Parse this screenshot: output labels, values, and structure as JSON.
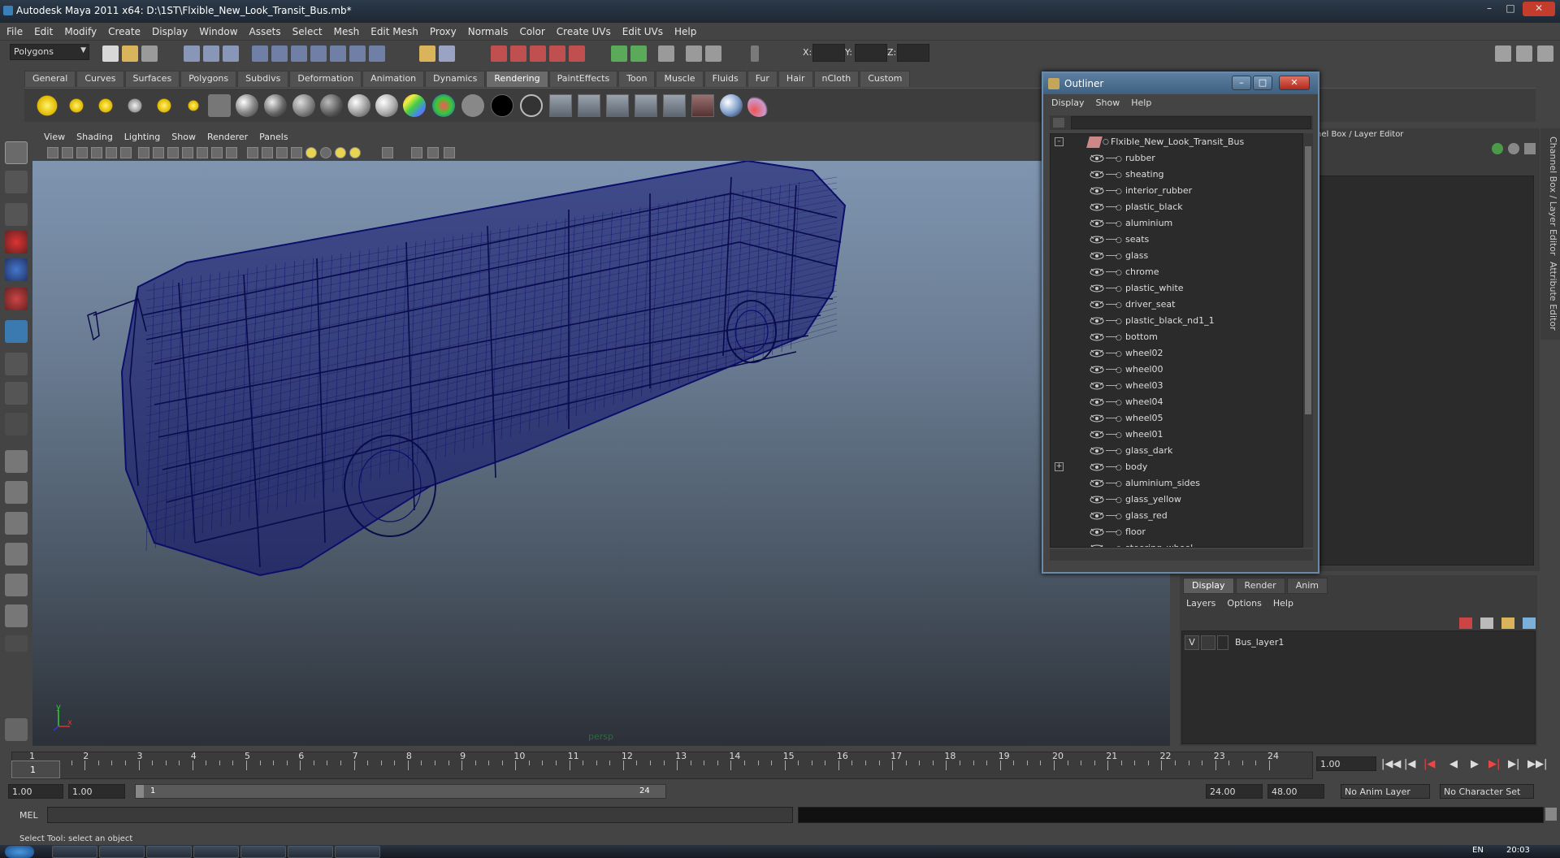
{
  "window": {
    "title": "Autodesk Maya 2011 x64: D:\\1ST\\Flxible_New_Look_Transit_Bus.mb*"
  },
  "menubar": [
    "File",
    "Edit",
    "Modify",
    "Create",
    "Display",
    "Window",
    "Assets",
    "Select",
    "Mesh",
    "Edit Mesh",
    "Proxy",
    "Normals",
    "Color",
    "Create UVs",
    "Edit UVs",
    "Help"
  ],
  "statusline": {
    "mode": "Polygons",
    "coord_x": "X:",
    "coord_y": "Y:",
    "coord_z": "Z:"
  },
  "shelf": {
    "tabs": [
      "General",
      "Curves",
      "Surfaces",
      "Polygons",
      "Subdivs",
      "Deformation",
      "Animation",
      "Dynamics",
      "Rendering",
      "PaintEffects",
      "Toon",
      "Muscle",
      "Fluids",
      "Fur",
      "Hair",
      "nCloth",
      "Custom"
    ],
    "active_tab": "Rendering"
  },
  "viewport": {
    "menu": [
      "View",
      "Shading",
      "Lighting",
      "Show",
      "Renderer",
      "Panels"
    ],
    "camera_label": "persp",
    "axis_y": "y",
    "axis_x": "x"
  },
  "channel_box": {
    "title": "nel Box / Layer Editor"
  },
  "side_tabs": [
    "Channel Box / Layer Editor",
    "Attribute Editor"
  ],
  "outliner": {
    "title": "Outliner",
    "menu": [
      "Display",
      "Show",
      "Help"
    ],
    "root": "Flxible_New_Look_Transit_Bus",
    "items": [
      "rubber",
      "sheating",
      "interior_rubber",
      "plastic_black",
      "aluminium",
      "seats",
      "glass",
      "chrome",
      "plastic_white",
      "driver_seat",
      "plastic_black_nd1_1",
      "bottom",
      "wheel02",
      "wheel00",
      "wheel03",
      "wheel04",
      "wheel05",
      "wheel01",
      "glass_dark",
      "body",
      "aluminium_sides",
      "glass_yellow",
      "glass_red",
      "floor",
      "steering_wheel"
    ],
    "expandable_item": "body"
  },
  "layer_editor": {
    "tabs": [
      "Display",
      "Render",
      "Anim"
    ],
    "active_tab": "Display",
    "menu": [
      "Layers",
      "Options",
      "Help"
    ],
    "layers": [
      {
        "visible": "V",
        "name": "Bus_layer1"
      }
    ]
  },
  "timeline": {
    "frames": [
      "1",
      "2",
      "3",
      "4",
      "5",
      "6",
      "7",
      "8",
      "9",
      "10",
      "11",
      "12",
      "13",
      "14",
      "15",
      "16",
      "17",
      "18",
      "19",
      "20",
      "21",
      "22",
      "23",
      "24"
    ],
    "current_frame": "1",
    "current_time_field": "1.00"
  },
  "range": {
    "start_time": "1.00",
    "playback_start": "1.00",
    "slider_start": "1",
    "slider_end": "24",
    "playback_end": "24.00",
    "end_time": "48.00",
    "anim_layer": "No Anim Layer",
    "character_set": "No Character Set"
  },
  "command_line": {
    "label": "MEL"
  },
  "help_line": {
    "text": "Select Tool: select an object"
  },
  "taskbar": {
    "clock": "20:03",
    "lang": "EN"
  },
  "colors": {
    "wireframe": "#0c0e6b",
    "viewport_top": "#7f95b0",
    "viewport_bottom": "#2c3138",
    "outliner_title": "#4f708f"
  }
}
